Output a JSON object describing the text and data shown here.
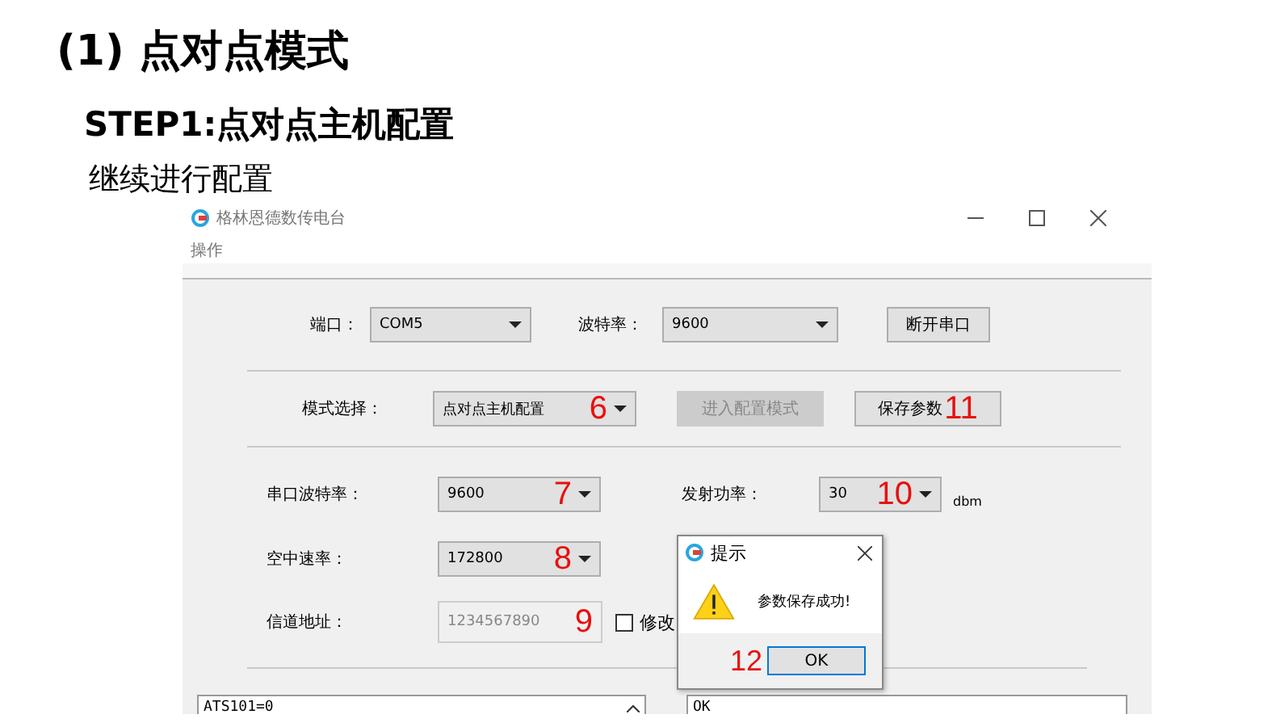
{
  "slide": {
    "heading": "(1) 点对点模式",
    "step": "STEP1:点对点主机配置",
    "note": "继续进行配置"
  },
  "window": {
    "title": "格林恩德数传电台",
    "menu": [
      "操作"
    ]
  },
  "rows": [
    [
      {
        "kind": "label",
        "text": "端口："
      },
      {
        "kind": "combo",
        "value": "COM5"
      },
      {
        "kind": "label",
        "text": "波特率："
      },
      {
        "kind": "combo",
        "value": "9600"
      },
      {
        "kind": "button",
        "text": "断开串口",
        "disabled": false
      }
    ],
    [
      {
        "kind": "label",
        "text": "模式选择："
      },
      {
        "kind": "combo",
        "value": "点对点主机配置",
        "marker": "6"
      },
      {
        "kind": "button",
        "text": "进入配置模式",
        "disabled": true
      },
      {
        "kind": "button",
        "text": "保存参数",
        "disabled": false,
        "marker": "11"
      }
    ],
    [
      {
        "kind": "label",
        "text": "串口波特率："
      },
      {
        "kind": "combo",
        "value": "9600",
        "marker": "7"
      },
      {
        "kind": "label",
        "text": "发射功率："
      },
      {
        "kind": "combo",
        "value": "30",
        "marker": "10"
      },
      {
        "kind": "unit",
        "text": "dbm"
      }
    ],
    [
      {
        "kind": "label",
        "text": "空中速率："
      },
      {
        "kind": "combo",
        "value": "172800",
        "marker": "8"
      }
    ],
    [
      {
        "kind": "label",
        "text": "信道地址："
      },
      {
        "kind": "input",
        "value": "1234567890",
        "disabled": true,
        "marker": "9"
      },
      {
        "kind": "checkbox",
        "text": "修改",
        "checked": false
      }
    ]
  ],
  "consoles": [
    {
      "text": "ATS101=0",
      "scroll": true
    },
    {
      "text": "OK",
      "scroll": false
    }
  ],
  "dialog": {
    "title": "提示",
    "message": "参数保存成功!",
    "button": "OK",
    "marker": "12"
  }
}
